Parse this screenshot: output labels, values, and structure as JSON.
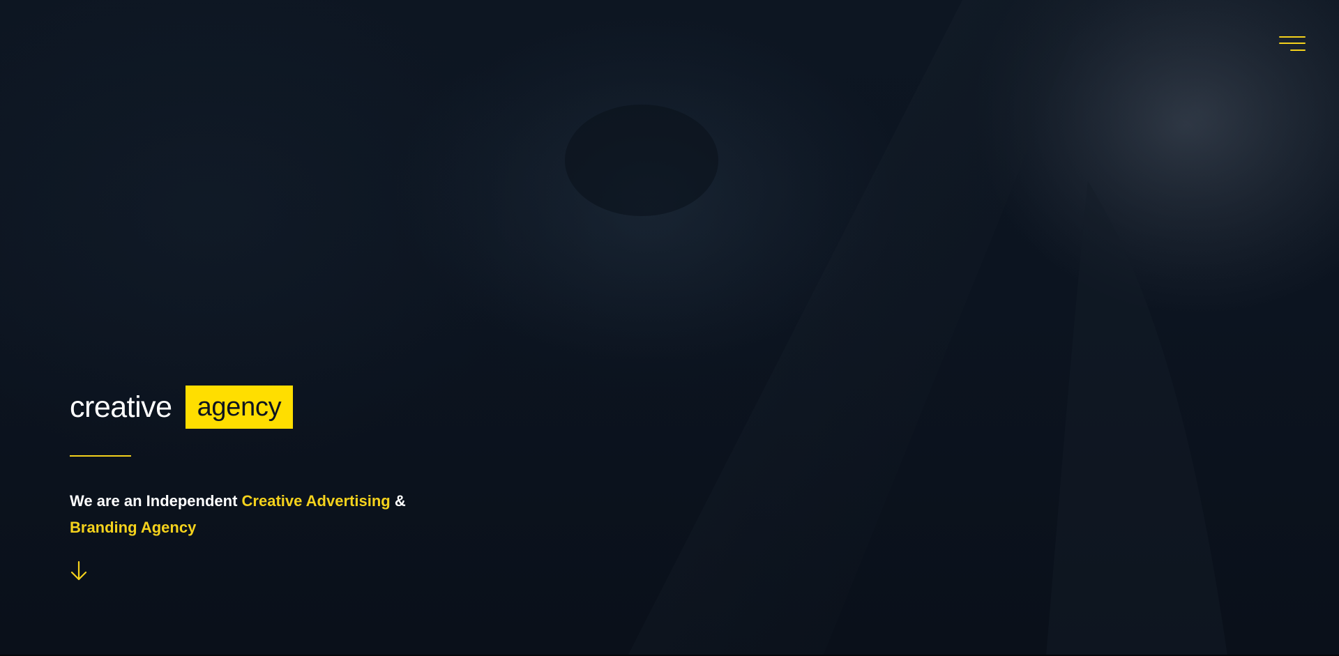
{
  "colors": {
    "accent": "#f5d21c",
    "logo_box": "#ffde00",
    "background": "#0b121c",
    "text": "#ffffff"
  },
  "header": {
    "menu_icon": "hamburger-menu-icon"
  },
  "logo": {
    "word": "creative",
    "boxed_word": "agency"
  },
  "hero": {
    "tagline_part1": "We are an Independent ",
    "tagline_highlight1": "Creative Advertising",
    "tagline_part2": " &",
    "tagline_highlight2": "Branding Agency",
    "scroll_icon": "arrow-down-icon"
  }
}
